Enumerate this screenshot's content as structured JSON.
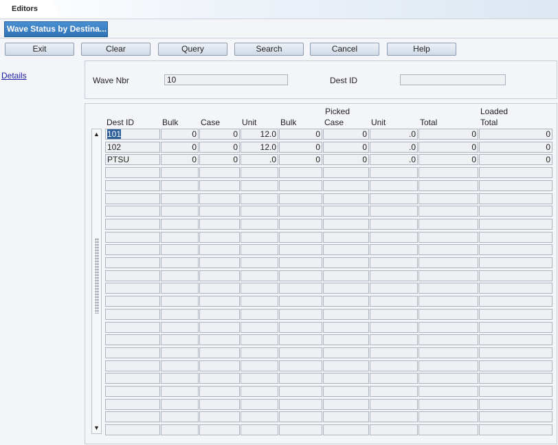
{
  "tabs": {
    "editors": "Editors",
    "screen": "Wave Status by Destina..."
  },
  "toolbar": {
    "buttons": [
      {
        "id": "exit",
        "label": "Exit"
      },
      {
        "id": "clear",
        "label": "Clear"
      },
      {
        "id": "query",
        "label": "Query"
      },
      {
        "id": "search",
        "label": "Search"
      },
      {
        "id": "cancel",
        "label": "Cancel"
      },
      {
        "id": "help",
        "label": "Help"
      }
    ]
  },
  "sidebar": {
    "details": "Details"
  },
  "filters": {
    "wave_nbr_label": "Wave Nbr",
    "wave_nbr_value": "10",
    "dest_id_label": "Dest ID",
    "dest_id_value": ""
  },
  "grid": {
    "group_headers": [
      "Picked",
      "Loaded"
    ],
    "columns": [
      "Dest ID",
      "Bulk",
      "Case",
      "Unit",
      "Bulk",
      "Case",
      "Unit",
      "Total",
      "Total"
    ],
    "rows": [
      [
        "101",
        "0",
        "0",
        "12.0",
        "0",
        "0",
        ".0",
        "0",
        "0"
      ],
      [
        "102",
        "0",
        "0",
        "12.0",
        "0",
        "0",
        ".0",
        "0",
        "0"
      ],
      [
        "PTSU",
        "0",
        "0",
        ".0",
        "0",
        "0",
        ".0",
        "0",
        "0"
      ]
    ],
    "total_rows": 24,
    "scroll_up": "▲",
    "scroll_down": "▼"
  }
}
